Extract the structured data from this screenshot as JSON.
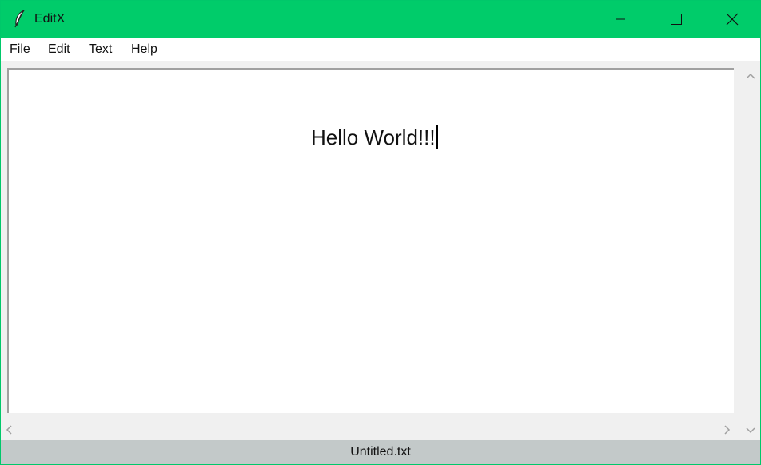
{
  "window": {
    "title": "EditX",
    "accent_color": "#00cc6a",
    "icon": "feather-icon"
  },
  "window_controls": {
    "minimize_icon": "minimize-icon",
    "maximize_icon": "maximize-icon",
    "close_icon": "close-icon"
  },
  "menu": {
    "items": [
      {
        "label": "File"
      },
      {
        "label": "Edit"
      },
      {
        "label": "Text"
      },
      {
        "label": "Help"
      }
    ]
  },
  "editor": {
    "content": "Hello World!!!"
  },
  "statusbar": {
    "filename": "Untitled.txt",
    "background": "#c3c9c9"
  }
}
